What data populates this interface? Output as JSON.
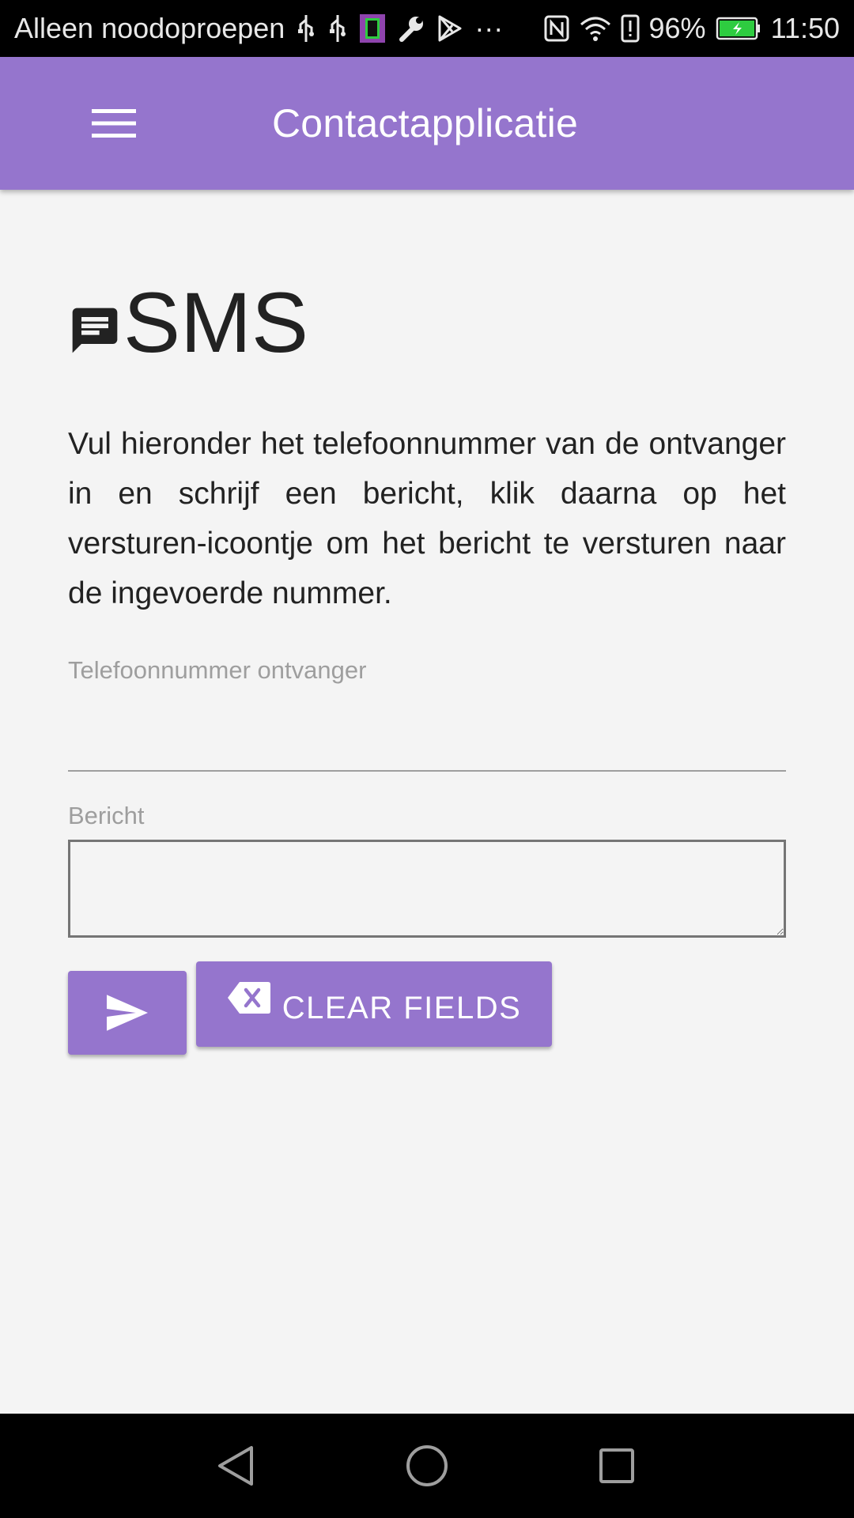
{
  "status_bar": {
    "carrier_text": "Alleen noodoproepen",
    "more_indicator": "···",
    "battery_percent": "96%",
    "time": "11:50",
    "icons": [
      "usb-icon",
      "usb-icon",
      "sim-icon",
      "wrench-icon",
      "play-store-icon",
      "nfc-icon",
      "wifi-icon",
      "alert-icon",
      "battery-icon"
    ]
  },
  "app_bar": {
    "title": "Contactapplicatie",
    "menu_icon": "hamburger-menu-icon",
    "color": "#9575cd"
  },
  "page": {
    "heading": "SMS",
    "heading_icon": "message-icon",
    "intro": "Vul hieronder het telefoonnummer van de ontvanger in en schrijf een bericht, klik daarna op het versturen-icoontje om het bericht te versturen naar de ingevoerde nummer."
  },
  "form": {
    "phone_label": "Telefoonnummer ontvanger",
    "phone_value": "",
    "message_label": "Bericht",
    "message_value": "",
    "send_icon": "send-icon",
    "clear_label": "CLEAR FIELDS",
    "clear_icon": "backspace-icon"
  },
  "nav_bar": {
    "back_icon": "back-triangle-icon",
    "home_icon": "home-circle-icon",
    "recents_icon": "recents-square-icon"
  }
}
